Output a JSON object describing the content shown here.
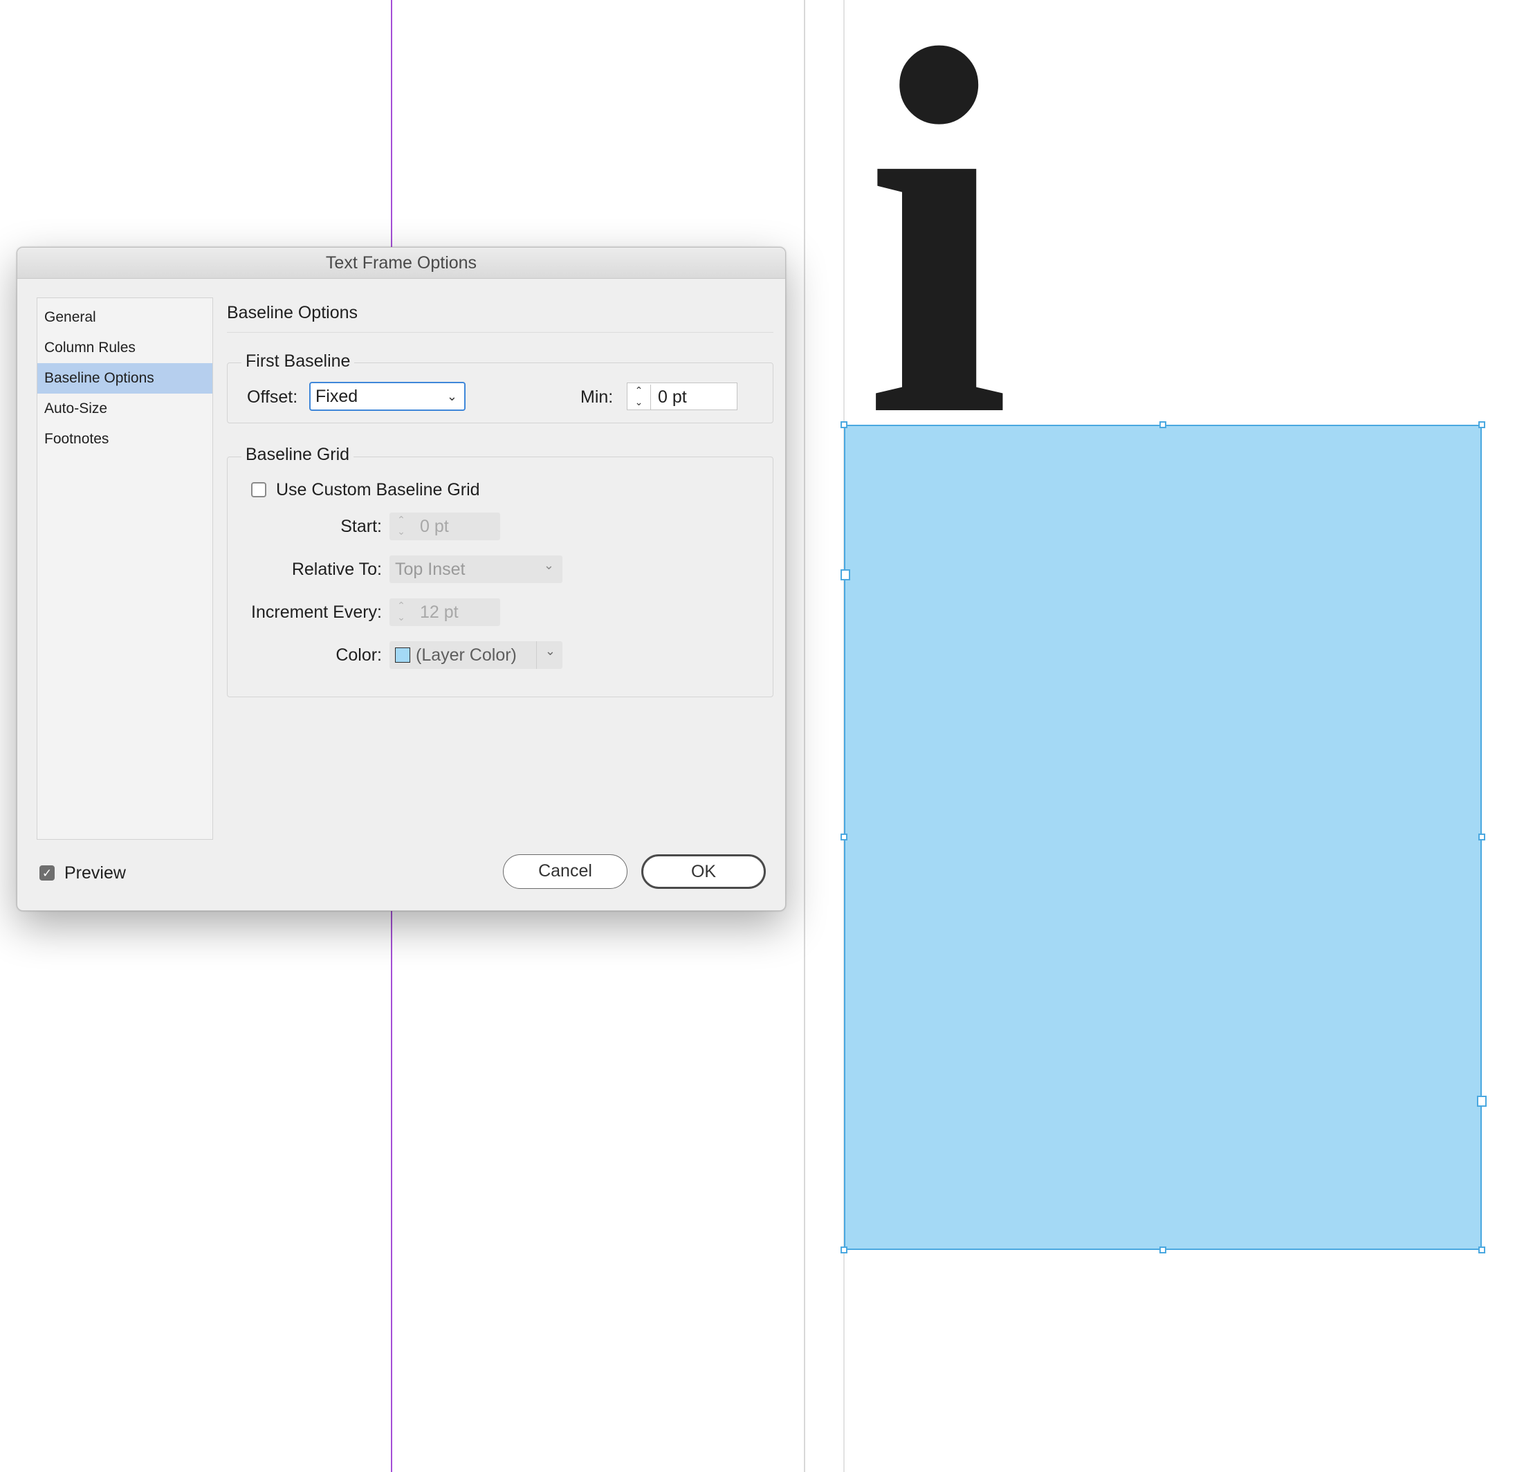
{
  "dialog": {
    "title": "Text Frame Options",
    "sidebar": [
      {
        "label": "General",
        "selected": false
      },
      {
        "label": "Column Rules",
        "selected": false
      },
      {
        "label": "Baseline Options",
        "selected": true
      },
      {
        "label": "Auto-Size",
        "selected": false
      },
      {
        "label": "Footnotes",
        "selected": false
      }
    ],
    "section_title": "Baseline Options",
    "first_baseline": {
      "title": "First Baseline",
      "offset_label": "Offset:",
      "offset_value": "Fixed",
      "min_label": "Min:",
      "min_value": "0 pt"
    },
    "baseline_grid": {
      "title": "Baseline Grid",
      "use_custom_label": "Use Custom Baseline Grid",
      "use_custom_checked": false,
      "start_label": "Start:",
      "start_value": "0 pt",
      "relative_to_label": "Relative To:",
      "relative_to_value": "Top Inset",
      "increment_label": "Increment Every:",
      "increment_value": "12 pt",
      "color_label": "Color:",
      "color_value": "(Layer Color)",
      "color_swatch": "#a4d9f5"
    },
    "preview_label": "Preview",
    "preview_checked": true,
    "cancel_label": "Cancel",
    "ok_label": "OK"
  },
  "canvas": {
    "glyph": "i",
    "frame_color": "#a4d9f5",
    "frame_border_color": "#4aa8e0",
    "guide_color": "#a44fd6"
  }
}
